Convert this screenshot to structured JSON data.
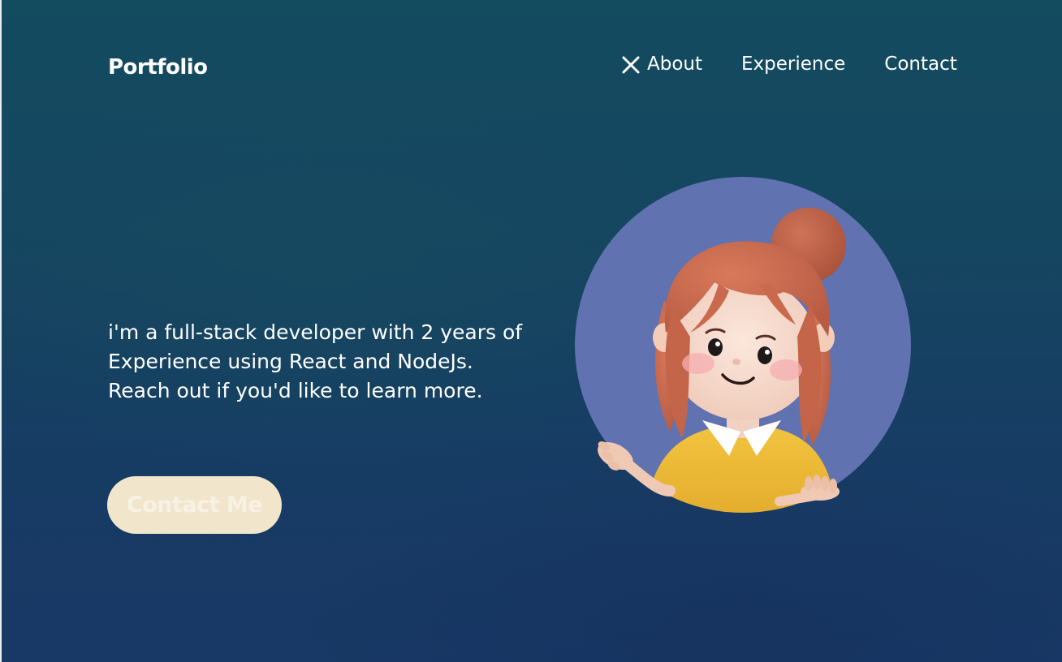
{
  "header": {
    "brand": "Portfolio",
    "nav": [
      {
        "label": "About",
        "icon": "close-icon"
      },
      {
        "label": "Experience"
      },
      {
        "label": "Contact"
      }
    ]
  },
  "hero": {
    "intro": "i'm a full-stack developer with 2 years of Experience using React and NodeJs. Reach out if you'd like to learn more.",
    "cta_label": "Contact Me"
  },
  "colors": {
    "background_top": "#134b5f",
    "background_bottom": "#183865",
    "avatar_circle": "#6172b1",
    "cta_background": "#f1e6cc"
  },
  "avatar": {
    "icon": "cartoon-girl-avatar"
  }
}
